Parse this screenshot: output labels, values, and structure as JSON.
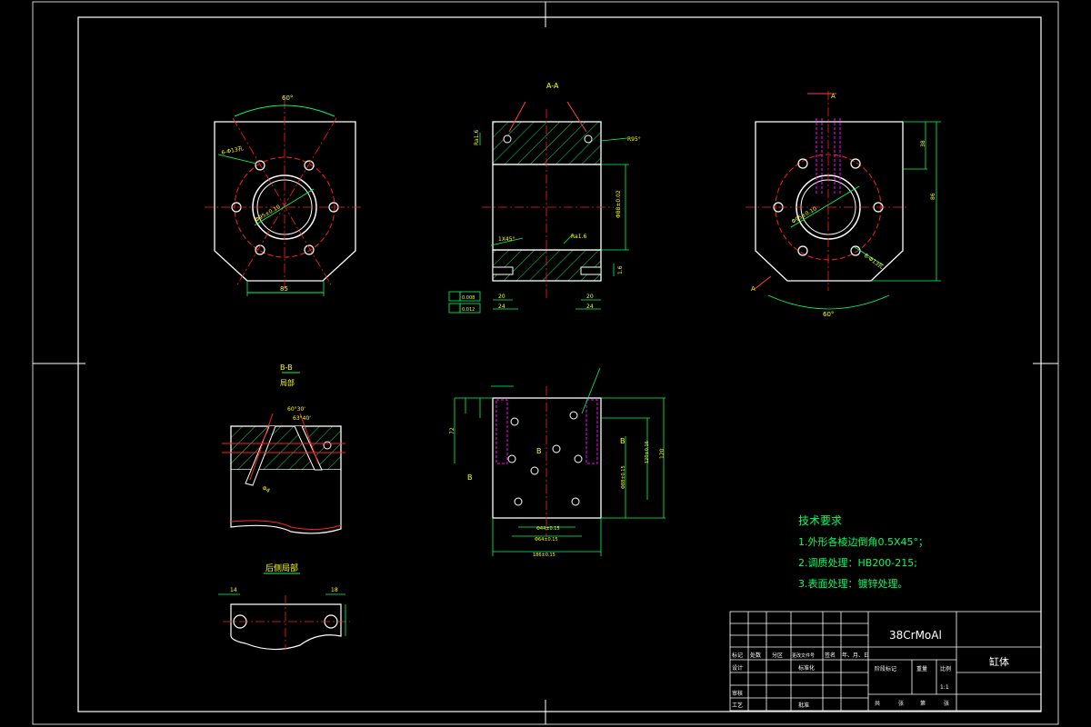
{
  "drawing": {
    "views": {
      "section_aa": "A-A",
      "arrow_a": "A",
      "detail_bb_title": "B-B",
      "detail_bb_sub": "局部",
      "rear_side_detail": "后侧局部",
      "section_b_left": "B",
      "section_b_mid": "B",
      "section_b_right": "B"
    },
    "dims": {
      "angle_60_top_left": "60°",
      "angle_60_right": "60°",
      "holes_left": "6-Φ13孔",
      "dia_left": "Φ95±0.10",
      "width_bottom_left": "85",
      "ra_top": "Ra1.6",
      "fillet": "R95°",
      "height_mid": "Φ88±0.02",
      "ra_mid": "Ra1.6",
      "ra_left": "1.6",
      "ra_right": "1.6",
      "chamfer_mid": "1X45°",
      "dim_20_left": "20",
      "dim_24_left": "24",
      "dim_20_right": "20",
      "dim_24_right": "24",
      "tol_a": "0.008",
      "tol_b": "0.012",
      "height_right_1": "38",
      "height_right_2": "86",
      "dia_right": "Φ95±0.10",
      "holes_right": "6-Φ13孔",
      "bb_angle_1": "60°30'",
      "bb_angle_2": "63°40'",
      "bb_dim": "Φ4",
      "rear_14": "14",
      "rear_18": "18",
      "bottom_a": "Φ44±0.15",
      "bottom_b": "Φ64±0.15",
      "bottom_c": "Φ88±0.15",
      "bottom_total": "186±0.15",
      "side_h1": "72",
      "side_h2": "120",
      "side_h3": "120±0.16"
    },
    "tech_req": {
      "title": "技术要求",
      "items": [
        "1.外形各棱边倒角0.5X45°；",
        "2.调质处理：HB200-215;",
        "3.表面处理：镀锌处理。"
      ]
    },
    "title_block": {
      "material": "38CrMoAl",
      "part_name": "缸体",
      "scale": "1:1",
      "row_labels": [
        "标记",
        "处数",
        "分区",
        "更改文件号",
        "签名",
        "年、月、日"
      ],
      "design": "设计",
      "standard": "标准化",
      "review": "审核",
      "process": "工艺",
      "approve": "批准",
      "stage_mark": "阶段标记",
      "weight": "重量",
      "scale_label": "比例",
      "sheet_total": "共",
      "sheet_of": "张",
      "sheet_no": "第",
      "sheet_zhang": "张"
    },
    "colors": {
      "outline": "#ffffff",
      "center": "#ff2020",
      "dim": "#00ff66",
      "hidden": "#ff00ff",
      "text": "#ffff00",
      "leader": "#ff4040"
    }
  }
}
